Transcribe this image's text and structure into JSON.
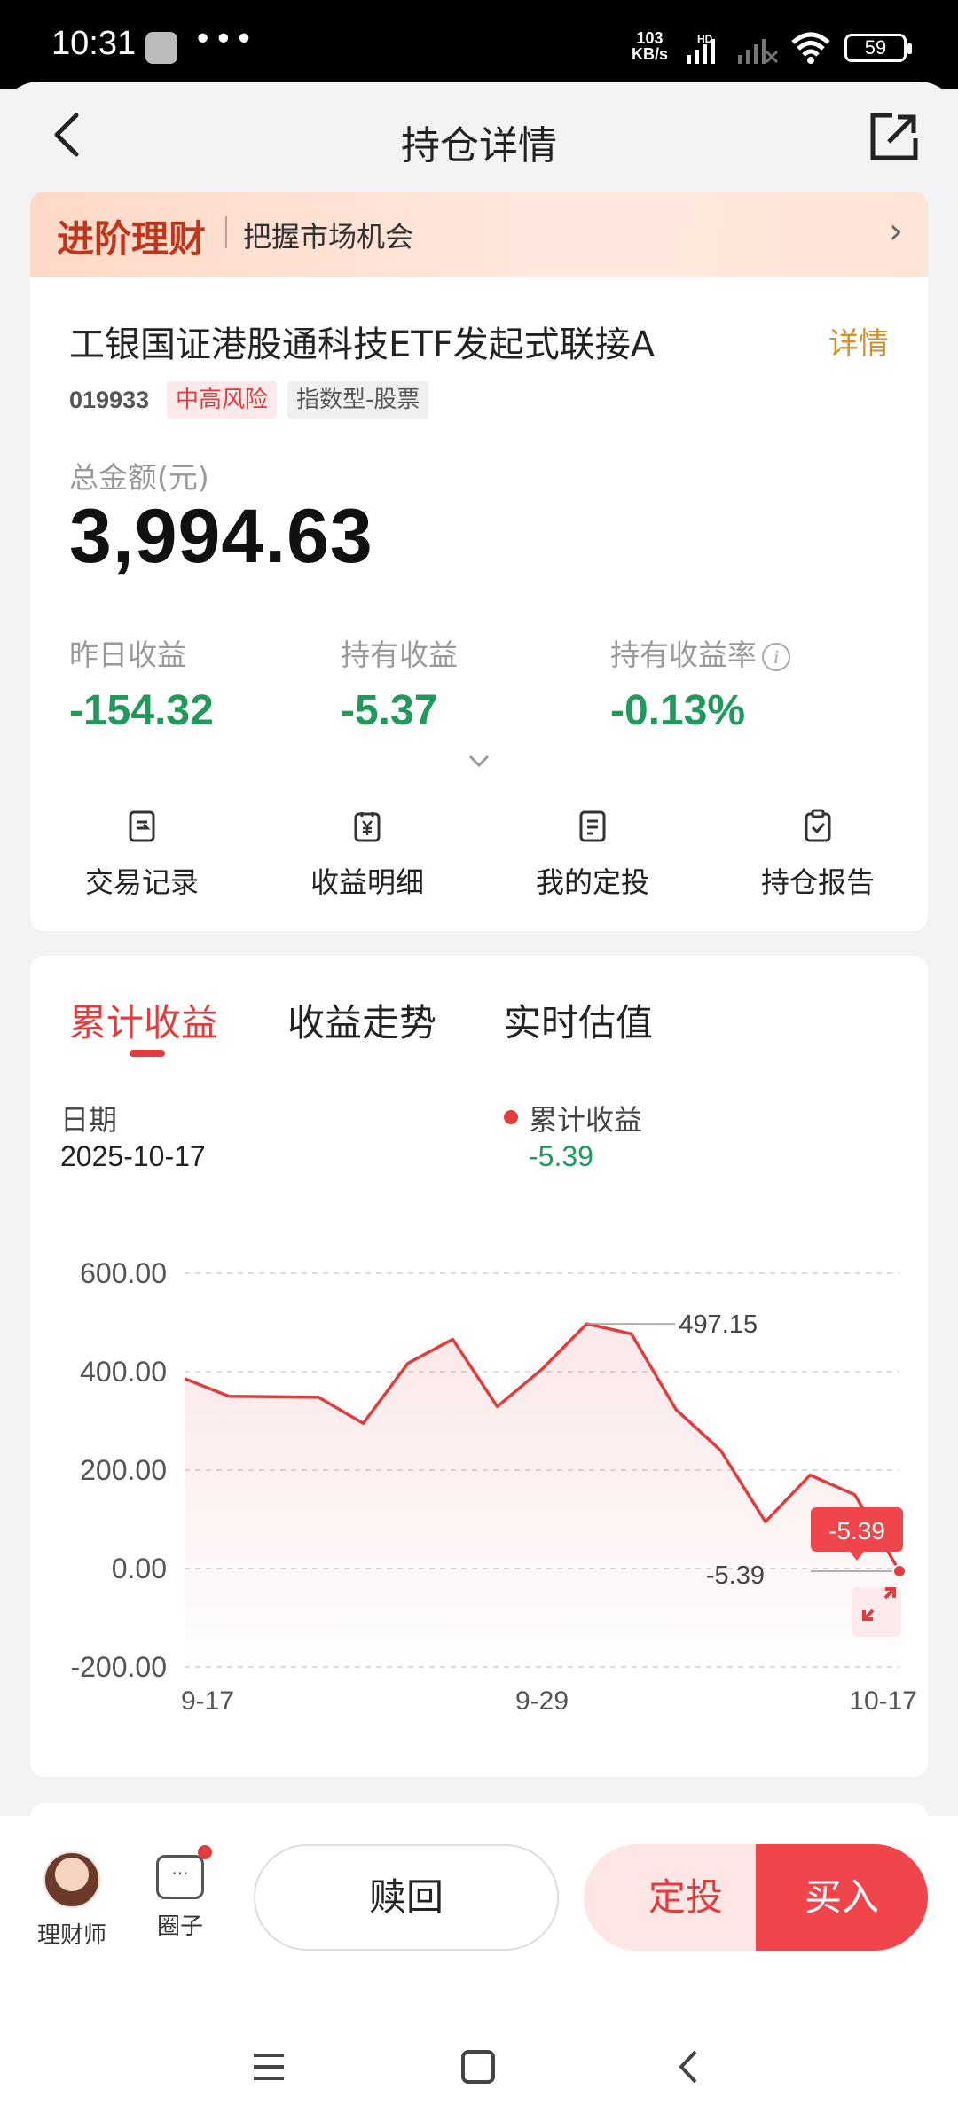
{
  "status_bar": {
    "time": "10:31",
    "dots": "•••",
    "net_speed_value": "103",
    "net_speed_unit": "KB/s",
    "hd": "HD",
    "battery": "59"
  },
  "nav": {
    "title": "持仓详情"
  },
  "promo": {
    "main": "进阶理财",
    "sub": "把握市场机会",
    "chevron": "›"
  },
  "fund": {
    "name": "工银国证港股通科技ETF发起式联接A",
    "detail_link": "详情",
    "code": "019933",
    "risk_tag": "中高风险",
    "type_tag": "指数型-股票",
    "total_label": "总金额(元)",
    "total_value": "3,994.63",
    "stats": [
      {
        "label": "昨日收益",
        "value": "-154.32"
      },
      {
        "label": "持有收益",
        "value": "-5.37"
      },
      {
        "label": "持有收益率",
        "value": "-0.13%"
      }
    ],
    "actions": [
      {
        "label": "交易记录",
        "icon": "receipt-icon"
      },
      {
        "label": "收益明细",
        "icon": "yen-document-icon"
      },
      {
        "label": "我的定投",
        "icon": "document-icon"
      },
      {
        "label": "持仓报告",
        "icon": "clipboard-check-icon"
      }
    ]
  },
  "chart_panel": {
    "tabs": [
      "累计收益",
      "收益走势",
      "实时估值"
    ],
    "active_tab": 0,
    "date_label": "日期",
    "date_value": "2025-10-17",
    "legend_label": "累计收益",
    "legend_value": "-5.39"
  },
  "chart_data": {
    "type": "area",
    "series": [
      {
        "name": "累计收益",
        "color": "#e23d3d",
        "x": [
          "9-17",
          "9-18",
          "9-19",
          "9-22",
          "9-23",
          "9-24",
          "9-25",
          "9-26",
          "9-29",
          "9-30",
          "10-9",
          "10-10",
          "10-13",
          "10-14",
          "10-15",
          "10-16",
          "10-17"
        ],
        "values": [
          386,
          350,
          349,
          348,
          295,
          417,
          466,
          329,
          405,
          497.15,
          477,
          323,
          240,
          95,
          190,
          150,
          -5.39
        ]
      }
    ],
    "y_ticks": [
      "600.00",
      "400.00",
      "200.00",
      "0.00",
      "-200.00"
    ],
    "ylim": [
      -200,
      600
    ],
    "x_ticks": [
      "9-17",
      "9-29",
      "10-17"
    ],
    "max_annotation": "497.15",
    "last_annotation": "-5.39",
    "last_badge": "-5.39",
    "grid": "dashed horizontal"
  },
  "bottom_bar": {
    "advisor_label": "理财师",
    "circle_label": "圈子",
    "circle_icon_text": "···",
    "redeem": "赎回",
    "auto_invest": "定投",
    "buy": "买入"
  }
}
